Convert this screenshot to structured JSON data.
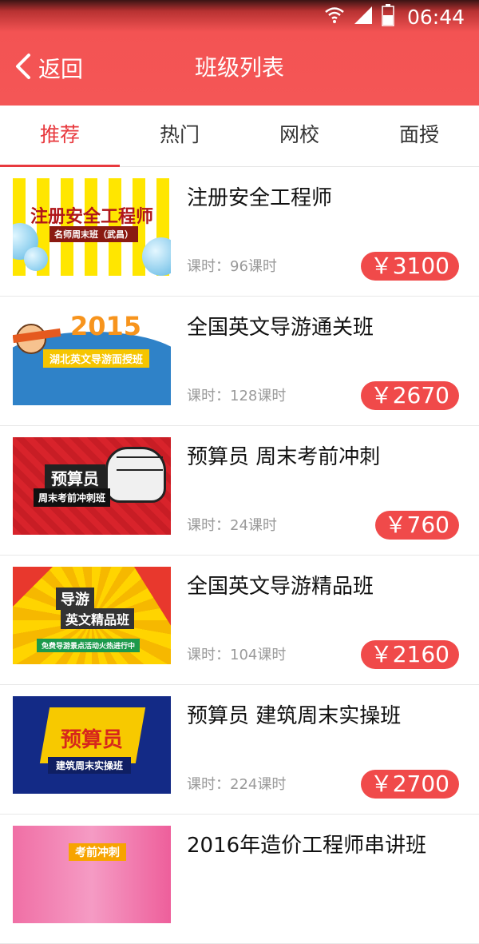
{
  "status": {
    "time": "06:44"
  },
  "header": {
    "back_label": "返回",
    "title": "班级列表"
  },
  "tabs": [
    {
      "label": "推荐",
      "active": true
    },
    {
      "label": "热门",
      "active": false
    },
    {
      "label": "网校",
      "active": false
    },
    {
      "label": "面授",
      "active": false
    }
  ],
  "courses": [
    {
      "title": "注册安全工程师",
      "hours": "课时：96课时",
      "price": "￥3100",
      "thumb": {
        "line1": "注册安全工程师",
        "line2": "名师周末班（武昌）"
      }
    },
    {
      "title": "全国英文导游通关班",
      "hours": "课时：128课时",
      "price": "￥2670",
      "thumb": {
        "line1": "2015",
        "line2": "湖北英文导游面授班"
      }
    },
    {
      "title": "预算员 周末考前冲刺",
      "hours": "课时：24课时",
      "price": "￥760",
      "thumb": {
        "line1": "预算员",
        "line2": "周末考前冲刺班"
      }
    },
    {
      "title": "全国英文导游精品班",
      "hours": "课时：104课时",
      "price": "￥2160",
      "thumb": {
        "line1": "导游",
        "line2": "英文精品班",
        "line3": "免费导游景点活动火热进行中"
      }
    },
    {
      "title": "预算员 建筑周末实操班",
      "hours": "课时：224课时",
      "price": "￥2700",
      "thumb": {
        "line1": "预算员",
        "line2": "建筑周末实操班"
      }
    },
    {
      "title": "2016年造价工程师串讲班",
      "hours": "",
      "price": "",
      "thumb": {
        "line1": "考前冲刺"
      }
    }
  ],
  "colors": {
    "header": "#f45656",
    "accent": "#e8393e",
    "price_badge": "#f04a4a"
  },
  "icons": {
    "status": [
      "wifi-icon",
      "signal-icon",
      "battery-icon"
    ],
    "back": "chevron-left-icon"
  }
}
